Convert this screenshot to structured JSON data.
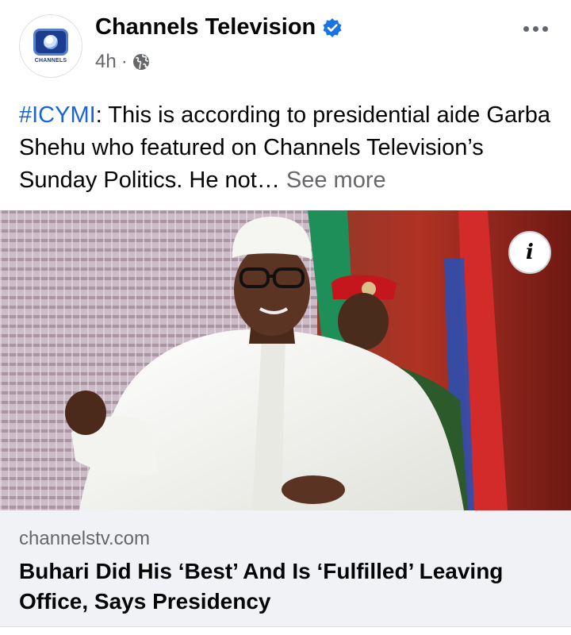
{
  "post": {
    "page_name": "Channels Television",
    "avatar_text": "CHANNELS",
    "time": "4h",
    "separator": "·",
    "text_hashtag": "#ICYMI",
    "text_body": ": This is according to presidential aide Garba Shehu who featured on Channels Television’s Sunday Politics. He not… ",
    "see_more": "See more"
  },
  "link_preview": {
    "info_label": "i",
    "domain": "channelstv.com",
    "title": "Buhari Did His ‘Best’ And Is ‘Fulfilled’ Leaving Office, Says Presidency"
  },
  "icons": {
    "verified": "verified-badge-icon",
    "audience": "globe-icon",
    "more": "more-dots-icon",
    "info": "info-icon"
  },
  "colors": {
    "accent": "#1864d8",
    "verified": "#1b74e4",
    "secondary_text": "#65676b",
    "link_footer_bg": "#f0f2f5"
  }
}
